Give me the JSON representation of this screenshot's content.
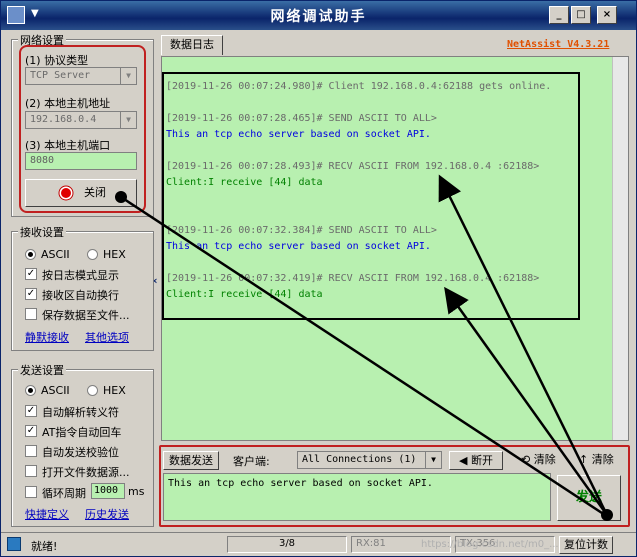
{
  "window": {
    "title": "网络调试助手",
    "brand": "NetAssist V4.3.21",
    "minimize": "_",
    "maximize": "□",
    "close": "×"
  },
  "network": {
    "group_title": "网络设置",
    "protocol_label": "(1) 协议类型",
    "protocol_value": "TCP Server",
    "host_label": "(2) 本地主机地址",
    "host_value": "192.168.0.4",
    "port_label": "(3) 本地主机端口",
    "port_value": "8080",
    "close_button": "关闭"
  },
  "receive": {
    "group_title": "接收设置",
    "ascii": "ASCII",
    "hex": "HEX",
    "opt_log_mode": "按日志模式显示",
    "opt_auto_wrap": "接收区自动换行",
    "opt_save_file": "保存数据至文件...",
    "link_silent": "静默接收",
    "link_other": "其他选项"
  },
  "send": {
    "group_title": "发送设置",
    "ascii": "ASCII",
    "hex": "HEX",
    "opt_escape": "自动解析转义符",
    "opt_at": "AT指令自动回车",
    "opt_checksum": "自动发送校验位",
    "opt_file_source": "打开文件数据源...",
    "opt_loop": "循环周期",
    "loop_value": "1000",
    "loop_unit": "ms",
    "link_shortcut": "快捷定义",
    "link_history": "历史发送"
  },
  "log": {
    "tab_label": "数据日志",
    "lines": [
      {
        "text": "[2019-11-26 00:07:24.980]# Client 192.168.0.4:62188 gets online.",
        "color": "gray"
      },
      {
        "text": "[2019-11-26 00:07:28.465]# SEND ASCII TO ALL>",
        "color": "gray"
      },
      {
        "text": "This an tcp echo server based on socket API.",
        "color": "blue"
      },
      {
        "text": "[2019-11-26 00:07:28.493]# RECV ASCII FROM 192.168.0.4 :62188>",
        "color": "gray"
      },
      {
        "text": "Client:I receive [44] data",
        "color": "green"
      },
      {
        "text": "[2019-11-26 00:07:32.384]# SEND ASCII TO ALL>",
        "color": "gray"
      },
      {
        "text": "This an tcp echo server based on socket API.",
        "color": "blue"
      },
      {
        "text": "[2019-11-26 00:07:32.419]# RECV ASCII FROM 192.168.0.4 :62188>",
        "color": "gray"
      },
      {
        "text": "Client:I receive [44] data",
        "color": "green"
      }
    ]
  },
  "sendbar": {
    "tab_label": "数据发送",
    "client_label": "客户端:",
    "client_value": "All Connections (1)",
    "disconnect": "断开",
    "clear1": "清除",
    "clear2": "清除",
    "input_text": "This an tcp echo server based on socket API.",
    "send_button": "发送"
  },
  "status": {
    "state": "就绪!",
    "count": "3/8",
    "rx": "RX:81",
    "tx": "TX:356",
    "reset": "复位计数",
    "watermark": "https://blog.csdn.net/m0_..."
  }
}
